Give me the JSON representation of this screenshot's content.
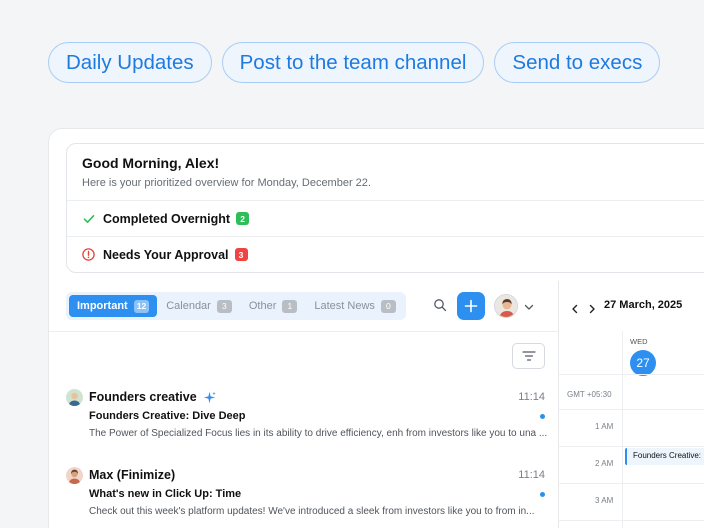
{
  "actions": {
    "daily_updates": "Daily Updates",
    "post_team": "Post to the team channel",
    "send_execs": "Send to execs"
  },
  "greeting": {
    "title": "Good Morning, Alex!",
    "subtitle": "Here is your prioritized overview for Monday, December 22.",
    "rows": [
      {
        "label": "Completed Overnight",
        "count": "2",
        "icon": "check-icon",
        "color": "#2ebd59"
      },
      {
        "label": "Needs Your Approval",
        "count": "3",
        "icon": "alert-circle-icon",
        "color": "#ef4444"
      }
    ]
  },
  "tabs": [
    {
      "label": "Important",
      "count": "12",
      "active": true
    },
    {
      "label": "Calendar",
      "count": "3",
      "active": false
    },
    {
      "label": "Other",
      "count": "1",
      "active": false
    },
    {
      "label": "Latest News",
      "count": "0",
      "active": false
    }
  ],
  "messages": [
    {
      "sender": "Founders creative",
      "time": "11:14",
      "subject": "Founders Creative: Dive Deep",
      "preview": "The Power of Specialized Focus lies in its ability to drive efficiency, enh from investors like you to una ...",
      "unread": true,
      "icon": "sparkle-icon"
    },
    {
      "sender": "Max (Finimize)",
      "time": "11:14",
      "subject": "What's new in Click Up: Time",
      "preview": "Check out this week's platform updates! We've introduced a sleek  from investors like you to from in...",
      "unread": true
    }
  ],
  "calendar": {
    "date_label": "27 March, 2025",
    "day_name": "WED",
    "day_number": "27",
    "timezone": "GMT +05:30",
    "hours": [
      "1 AM",
      "2 AM",
      "3 AM"
    ],
    "event": "Founders Creative:"
  },
  "colors": {
    "accent": "#2d8ff0",
    "success": "#2ebd59",
    "danger": "#ef4444"
  }
}
